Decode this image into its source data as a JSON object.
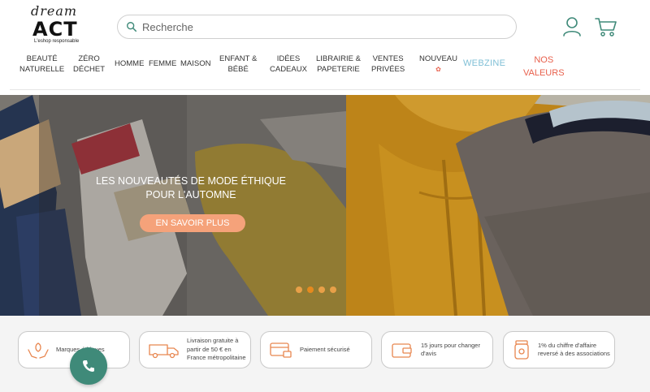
{
  "logo": {
    "script": "dream",
    "brand": "ACT",
    "tagline": "L'eshop responsable"
  },
  "search": {
    "placeholder": "Recherche"
  },
  "nav": {
    "items": [
      {
        "line1": "BEAUTÉ",
        "line2": "NATURELLE"
      },
      {
        "line1": "ZÉRO",
        "line2": "DÉCHET"
      },
      {
        "line1": "HOMME",
        "line2": ""
      },
      {
        "line1": "FEMME",
        "line2": ""
      },
      {
        "line1": "MAISON",
        "line2": ""
      },
      {
        "line1": "ENFANT &",
        "line2": "BÉBÉ"
      },
      {
        "line1": "IDÉES",
        "line2": "CADEAUX"
      },
      {
        "line1": "LIBRAIRIE &",
        "line2": "PAPETERIE"
      },
      {
        "line1": "VENTES",
        "line2": "PRIVÉES"
      },
      {
        "line1": "NOUVEAU",
        "line2": "✿"
      }
    ],
    "webzine": "WEBZINE",
    "valeurs_line1": "NOS",
    "valeurs_line2": "VALEURS"
  },
  "hero": {
    "title": "LES NOUVEAUTÉS DE MODE ÉTHIQUE POUR L'AUTOMNE",
    "button": "EN SAVOIR PLUS",
    "slides": 4,
    "active_slide": 2
  },
  "features": [
    {
      "icon": "hands-leaf-icon",
      "text": "Marques éthiques"
    },
    {
      "icon": "truck-icon",
      "text": "Livraison gratuite à partir de 50 € en France métropolitaine"
    },
    {
      "icon": "card-lock-icon",
      "text": "Paiement sécurisé"
    },
    {
      "icon": "wallet-icon",
      "text": "15 jours pour changer d'avis"
    },
    {
      "icon": "jar-icon",
      "text": "1% du chiffre d'affaire reversé à des associations"
    }
  ],
  "colors": {
    "accent": "#3f8a79",
    "webzine": "#7fbfd6",
    "valeurs": "#e8604c",
    "hero_button": "#f5a27a",
    "feature_icon": "#e8864f"
  }
}
